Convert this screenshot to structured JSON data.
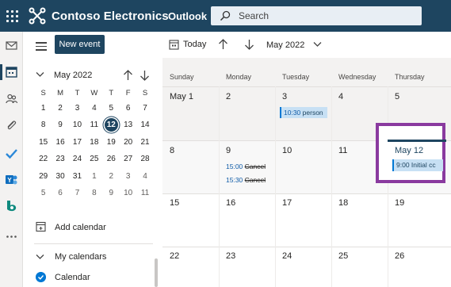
{
  "header": {
    "brand": "Contoso Electronics",
    "app": "Outlook",
    "search_placeholder": "Search"
  },
  "sidebar": {
    "new_event_label": "New event",
    "mini_calendar": {
      "title": "May 2022",
      "weekdays": [
        "S",
        "M",
        "T",
        "W",
        "T",
        "F",
        "S"
      ],
      "weeks": [
        [
          "1",
          "2",
          "3",
          "4",
          "5",
          "6",
          "7"
        ],
        [
          "8",
          "9",
          "10",
          "11",
          "12",
          "13",
          "14"
        ],
        [
          "15",
          "16",
          "17",
          "18",
          "19",
          "20",
          "21"
        ],
        [
          "22",
          "23",
          "24",
          "25",
          "26",
          "27",
          "28"
        ],
        [
          "29",
          "30",
          "31",
          "1",
          "2",
          "3",
          "4"
        ],
        [
          "5",
          "6",
          "7",
          "8",
          "9",
          "10",
          "11"
        ]
      ],
      "today": "12"
    },
    "add_calendar_label": "Add calendar",
    "my_calendars_label": "My calendars",
    "calendar_item_label": "Calendar"
  },
  "toolbar": {
    "today_label": "Today",
    "month_label": "May 2022"
  },
  "calendar": {
    "weekdays": [
      "Sunday",
      "Monday",
      "Tuesday",
      "Wednesday",
      "Thursday"
    ],
    "weeks": [
      [
        "May 1",
        "2",
        "3",
        "4",
        "5"
      ],
      [
        "8",
        "9",
        "10",
        "11",
        "May 12"
      ],
      [
        "15",
        "16",
        "17",
        "18",
        "19"
      ],
      [
        "22",
        "23",
        "24",
        "25",
        "26"
      ]
    ],
    "events": {
      "tue_may3": {
        "time": "10:30",
        "title": "person"
      },
      "mon_may9_a": {
        "time": "15:00",
        "title": "Cancel"
      },
      "mon_may9_b": {
        "time": "15:30",
        "title": "Cancel"
      },
      "thu_may12": {
        "time": "9:00",
        "title": "Initial cc"
      }
    }
  },
  "colors": {
    "header_bg": "#1e4560",
    "highlight": "#8a3a9f",
    "event_bg": "#c7e0f4"
  }
}
